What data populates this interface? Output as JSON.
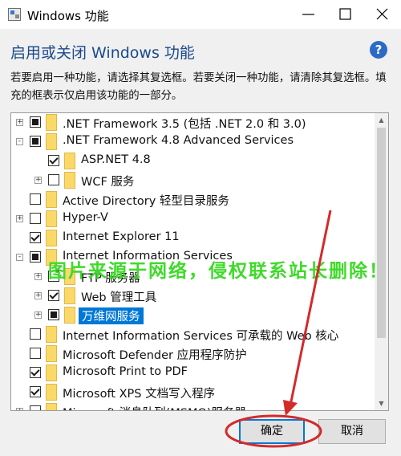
{
  "window": {
    "title": "Windows 功能",
    "heading": "启用或关闭 Windows 功能",
    "description": "若要启用一种功能，请选择其复选框。若要关闭一种功能，请清除其复选框。填充的框表示仅启用该功能的一部分。",
    "help_symbol": "?"
  },
  "features": [
    {
      "label": ".NET Framework 3.5 (包括 .NET 2.0 和 3.0)",
      "expander": "+",
      "state": "partial"
    },
    {
      "label": ".NET Framework 4.8 Advanced Services",
      "expander": "-",
      "state": "partial"
    },
    {
      "label": "ASP.NET 4.8",
      "expander": "",
      "state": "checked"
    },
    {
      "label": "WCF 服务",
      "expander": "+",
      "state": "unchecked"
    },
    {
      "label": "Active Directory 轻型目录服务",
      "expander": "",
      "state": "unchecked"
    },
    {
      "label": "Hyper-V",
      "expander": "+",
      "state": "unchecked"
    },
    {
      "label": "Internet Explorer 11",
      "expander": "",
      "state": "checked"
    },
    {
      "label": "Internet Information Services",
      "expander": "-",
      "state": "partial"
    },
    {
      "label": "FTP 服务器",
      "expander": "+",
      "state": "unchecked"
    },
    {
      "label": "Web 管理工具",
      "expander": "+",
      "state": "checked"
    },
    {
      "label": "万维网服务",
      "expander": "+",
      "state": "partial",
      "selected": true
    },
    {
      "label": "Internet Information Services 可承载的 Web 核心",
      "expander": "",
      "state": "unchecked"
    },
    {
      "label": "Microsoft Defender 应用程序防护",
      "expander": "",
      "state": "unchecked"
    },
    {
      "label": "Microsoft Print to PDF",
      "expander": "",
      "state": "checked"
    },
    {
      "label": "Microsoft XPS 文档写入程序",
      "expander": "",
      "state": "checked"
    },
    {
      "label": "Microsoft 消息队列(MSMQ)服务器",
      "expander": "+",
      "state": "unchecked"
    }
  ],
  "buttons": {
    "ok": "确定",
    "cancel": "取消"
  },
  "watermark": "图片来源于网络，侵权联系站长删除！",
  "colors": {
    "heading": "#1a4a8a",
    "selection": "#0078d7",
    "annotation_red": "#d42a2a",
    "watermark_green": "#3fda2a"
  }
}
